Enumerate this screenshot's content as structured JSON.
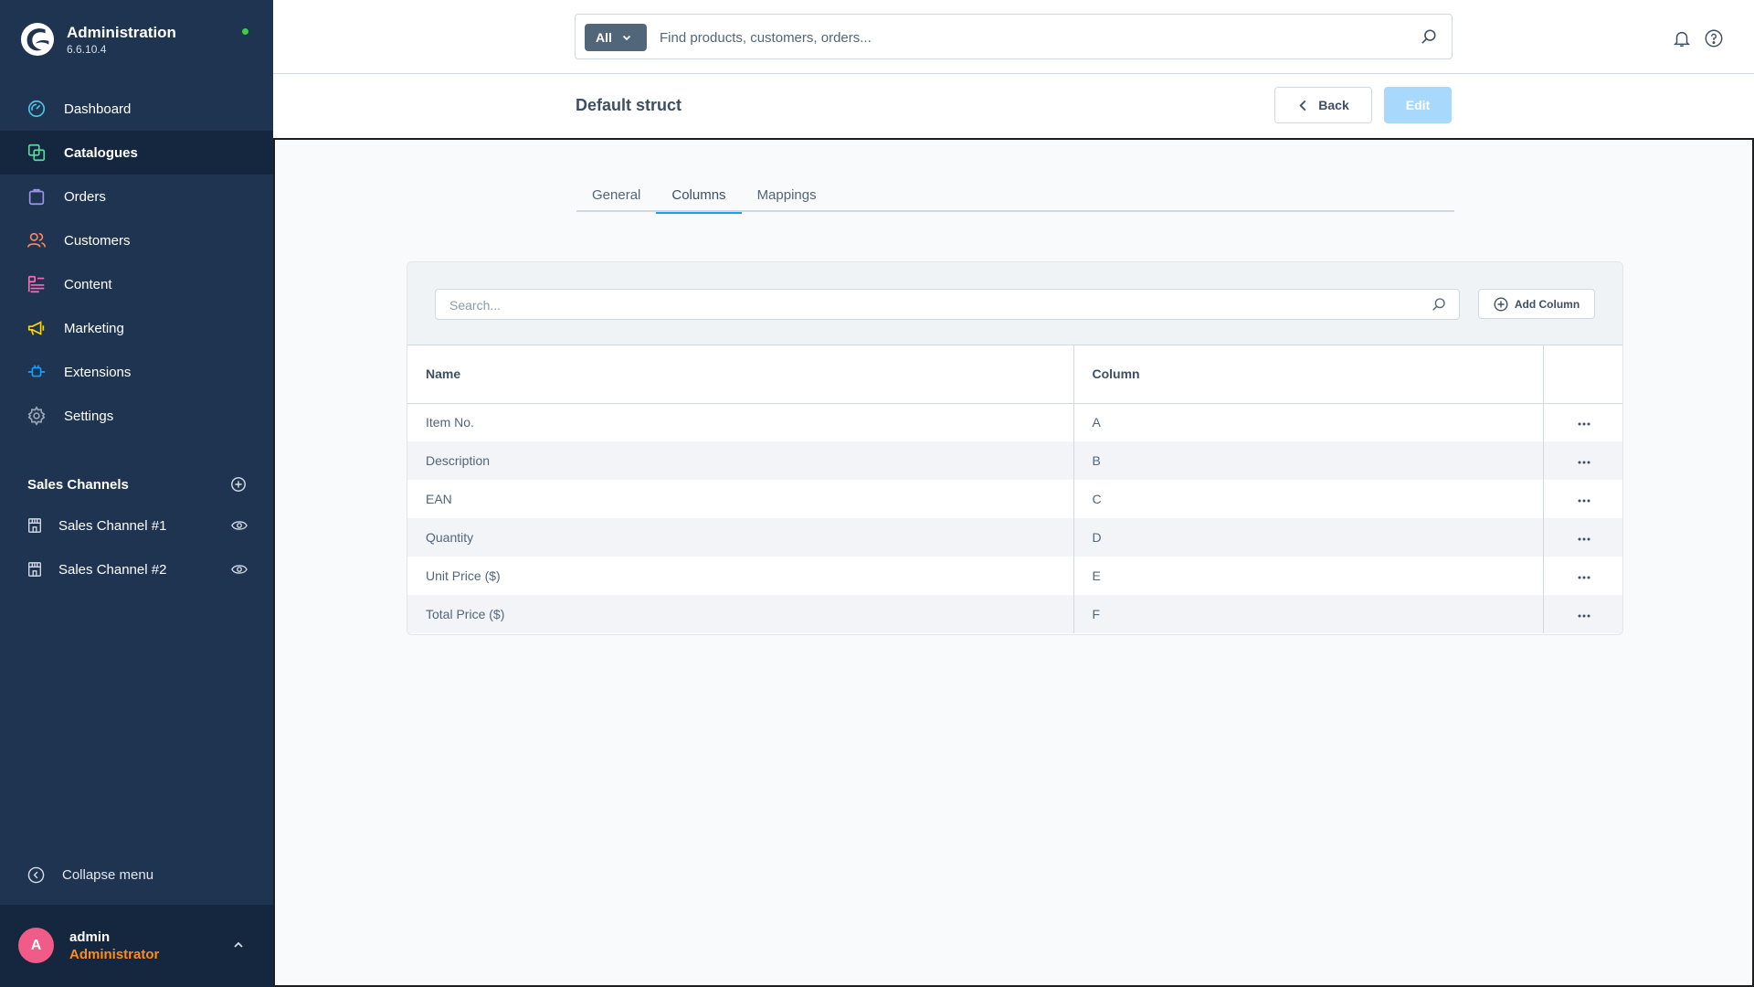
{
  "brand": {
    "title": "Administration",
    "version": "6.6.10.4",
    "status_color": "#37d046"
  },
  "sidebar": {
    "items": [
      {
        "label": "Dashboard",
        "icon": "dashboard-icon",
        "color": "#50c2e6"
      },
      {
        "label": "Catalogues",
        "icon": "catalogue-icon",
        "color": "#57d9a3",
        "active": true
      },
      {
        "label": "Orders",
        "icon": "shopping-bag-icon",
        "color": "#a092f0"
      },
      {
        "label": "Customers",
        "icon": "customers-icon",
        "color": "#f88962"
      },
      {
        "label": "Content",
        "icon": "content-icon",
        "color": "#ff68b4"
      },
      {
        "label": "Marketing",
        "icon": "megaphone-icon",
        "color": "#ffd700"
      },
      {
        "label": "Extensions",
        "icon": "plug-icon",
        "color": "#189eff"
      },
      {
        "label": "Settings",
        "icon": "gear-icon",
        "color": "#9aa8b5"
      }
    ],
    "sales_channels_title": "Sales Channels",
    "sales_channels": [
      {
        "label": "Sales Channel #1"
      },
      {
        "label": "Sales Channel #2"
      }
    ],
    "collapse_label": "Collapse menu"
  },
  "user": {
    "initial": "A",
    "name": "admin",
    "role": "Administrator",
    "avatar_color": "#f05b87",
    "role_color": "#ff8a1e"
  },
  "search": {
    "type_label": "All",
    "placeholder": "Find products, customers, orders..."
  },
  "smartbar": {
    "title": "Default struct",
    "back_label": "Back",
    "edit_label": "Edit"
  },
  "tabs": [
    {
      "label": "General"
    },
    {
      "label": "Columns",
      "active": true
    },
    {
      "label": "Mappings"
    }
  ],
  "grid": {
    "search_placeholder": "Search...",
    "add_label": "Add Column",
    "headers": {
      "name": "Name",
      "column": "Column"
    },
    "rows": [
      {
        "name": "Item No.",
        "column": "A"
      },
      {
        "name": "Description",
        "column": "B"
      },
      {
        "name": "EAN",
        "column": "C"
      },
      {
        "name": "Quantity",
        "column": "D"
      },
      {
        "name": "Unit Price ($)",
        "column": "E"
      },
      {
        "name": "Total Price ($)",
        "column": "F"
      }
    ]
  }
}
